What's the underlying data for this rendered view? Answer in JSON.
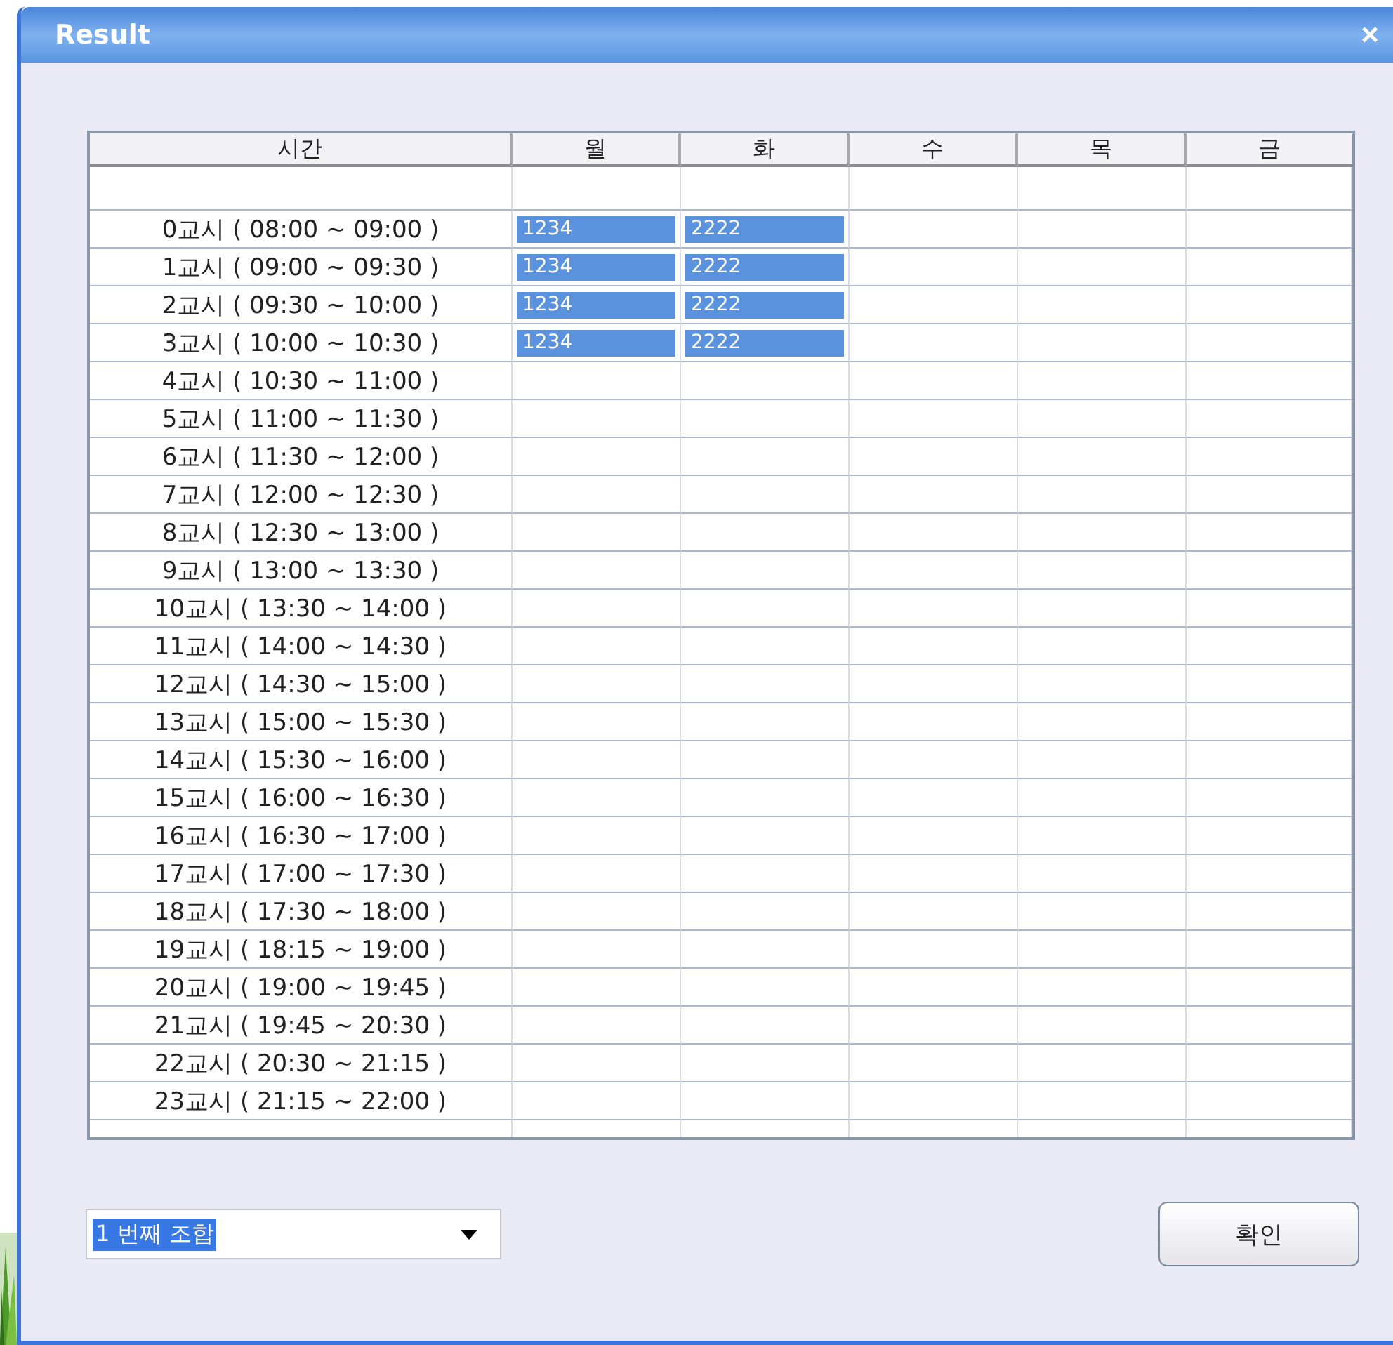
{
  "window": {
    "title": "Result",
    "close": "×"
  },
  "table": {
    "columns": [
      "시간",
      "월",
      "화",
      "수",
      "목",
      "금"
    ],
    "rows": [
      {
        "label": "0교시 ( 08:00 ~ 09:00 )",
        "cells": [
          {
            "text": "1234",
            "selected": true
          },
          {
            "text": "2222",
            "selected": true
          }
        ]
      },
      {
        "label": "1교시 ( 09:00 ~ 09:30 )",
        "cells": [
          {
            "text": "1234",
            "selected": true
          },
          {
            "text": "2222",
            "selected": true
          }
        ]
      },
      {
        "label": "2교시 ( 09:30 ~ 10:00 )",
        "cells": [
          {
            "text": "1234",
            "selected": true
          },
          {
            "text": "2222",
            "selected": true
          }
        ]
      },
      {
        "label": "3교시 ( 10:00 ~ 10:30 )",
        "cells": [
          {
            "text": "1234",
            "selected": true
          },
          {
            "text": "2222",
            "selected": true
          }
        ]
      },
      {
        "label": "4교시 ( 10:30 ~ 11:00 )"
      },
      {
        "label": "5교시 ( 11:00 ~ 11:30 )"
      },
      {
        "label": "6교시 ( 11:30 ~ 12:00 )"
      },
      {
        "label": "7교시 ( 12:00 ~ 12:30 )"
      },
      {
        "label": "8교시 ( 12:30 ~ 13:00 )"
      },
      {
        "label": "9교시 ( 13:00 ~ 13:30 )"
      },
      {
        "label": "10교시 ( 13:30 ~ 14:00 )"
      },
      {
        "label": "11교시 ( 14:00 ~ 14:30 )"
      },
      {
        "label": "12교시 ( 14:30 ~ 15:00 )"
      },
      {
        "label": "13교시 ( 15:00 ~ 15:30 )"
      },
      {
        "label": "14교시 ( 15:30 ~ 16:00 )"
      },
      {
        "label": "15교시 ( 16:00 ~ 16:30 )"
      },
      {
        "label": "16교시 ( 16:30 ~ 17:00 )"
      },
      {
        "label": "17교시 ( 17:00 ~ 17:30 )"
      },
      {
        "label": "18교시 ( 17:30 ~ 18:00 )"
      },
      {
        "label": "19교시 ( 18:15 ~ 19:00 )"
      },
      {
        "label": "20교시 ( 19:00 ~ 19:45 )"
      },
      {
        "label": "21교시 ( 19:45 ~ 20:30 )"
      },
      {
        "label": "22교시 ( 20:30 ~ 21:15 )"
      },
      {
        "label": "23교시 ( 21:15 ~ 22:00 )"
      }
    ]
  },
  "combination_dropdown": {
    "value": "1 번째 조합"
  },
  "buttons": [
    "확인"
  ]
}
